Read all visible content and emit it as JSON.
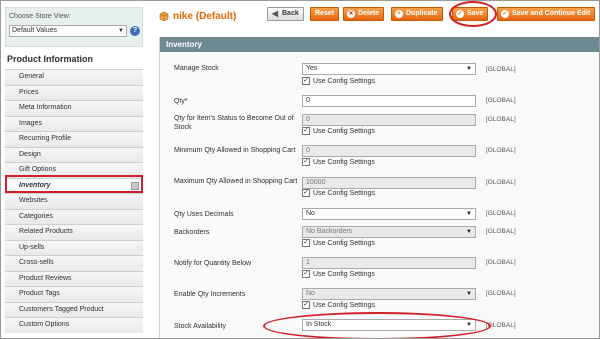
{
  "sidebar": {
    "store_label": "Choose Store View:",
    "store_value": "Default Values",
    "title": "Product Information",
    "items": [
      {
        "label": "General"
      },
      {
        "label": "Prices"
      },
      {
        "label": "Meta Information"
      },
      {
        "label": "Images"
      },
      {
        "label": "Recurring Profile"
      },
      {
        "label": "Design"
      },
      {
        "label": "Gift Options"
      },
      {
        "label": "Inventory"
      },
      {
        "label": "Websites"
      },
      {
        "label": "Categories"
      },
      {
        "label": "Related Products"
      },
      {
        "label": "Up-sells"
      },
      {
        "label": "Cross-sells"
      },
      {
        "label": "Product Reviews"
      },
      {
        "label": "Product Tags"
      },
      {
        "label": "Customers Tagged Product"
      },
      {
        "label": "Custom Options"
      }
    ],
    "active_index": 7
  },
  "header": {
    "title": "nike (Default)",
    "buttons": {
      "back": "Back",
      "reset": "Reset",
      "delete": "Delete",
      "duplicate": "Duplicate",
      "save": "Save",
      "save_continue": "Save and Continue Edit"
    }
  },
  "section": {
    "title": "Inventory",
    "scope": "[GLOBAL]",
    "config_label": "Use Config Settings",
    "rows": [
      {
        "label": "Manage Stock",
        "value": "Yes"
      },
      {
        "label": "Qty*",
        "value": "0"
      },
      {
        "label": "Qty for Item's Status to Become Out of Stock",
        "value": "0"
      },
      {
        "label": "Minimum Qty Allowed in Shopping Cart",
        "value": "0"
      },
      {
        "label": "Maximum Qty Allowed in Shopping Cart",
        "value": "10000"
      },
      {
        "label": "Qty Uses Decimals",
        "value": "No"
      },
      {
        "label": "Backorders",
        "value": "No Backorders"
      },
      {
        "label": "Notify for Quantity Below",
        "value": "1"
      },
      {
        "label": "Enable Qty Increments",
        "value": "No"
      },
      {
        "label": "Stock Availability",
        "value": "In Stock"
      }
    ]
  },
  "colors": {
    "accent": "#e26703",
    "section_header": "#6f8992",
    "highlight": "#d2202b"
  }
}
